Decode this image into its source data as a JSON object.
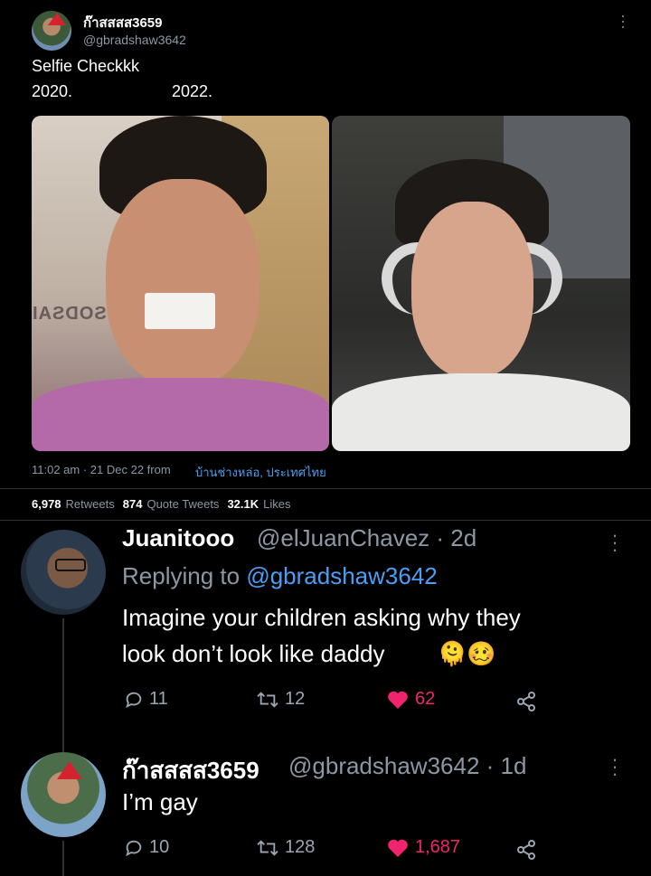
{
  "tweet": {
    "author_name": "ก๊าสสสส3659",
    "author_handle": "@gbradshaw3642",
    "text_line1": "Selfie Checkkk",
    "year_left": "2020.",
    "year_right": "2022.",
    "time": "11:02 am · 21 Dec 22 from",
    "location": "บ้านช่างหล่อ, ประเทศไทย",
    "photo_left_sign": "SODSAI",
    "stats": {
      "retweets_count": "6,978",
      "retweets_label": "Retweets",
      "quotes_count": "874",
      "quotes_label": "Quote Tweets",
      "likes_count": "32.1K",
      "likes_label": "Likes"
    }
  },
  "replies": [
    {
      "name": "Juanitooo",
      "handle": "@elJuanChavez · 2d",
      "replying_prefix": "Replying to",
      "replying_to": "@gbradshaw3642",
      "text_line1": "Imagine your children asking why they",
      "text_line2": "look don’t look like daddy",
      "emoji": "🫠🥴",
      "replies": "11",
      "retweets": "12",
      "likes": "62"
    },
    {
      "name": "ก๊าสสสส3659",
      "handle": "@gbradshaw3642 · 1d",
      "text_line1": "I’m gay",
      "replies": "10",
      "retweets": "128",
      "likes": "1,687"
    }
  ],
  "colors": {
    "background": "#000000",
    "text": "#e7e9ea",
    "muted": "#8b98a5",
    "link": "#4a9ff5",
    "like": "#f0246e"
  }
}
